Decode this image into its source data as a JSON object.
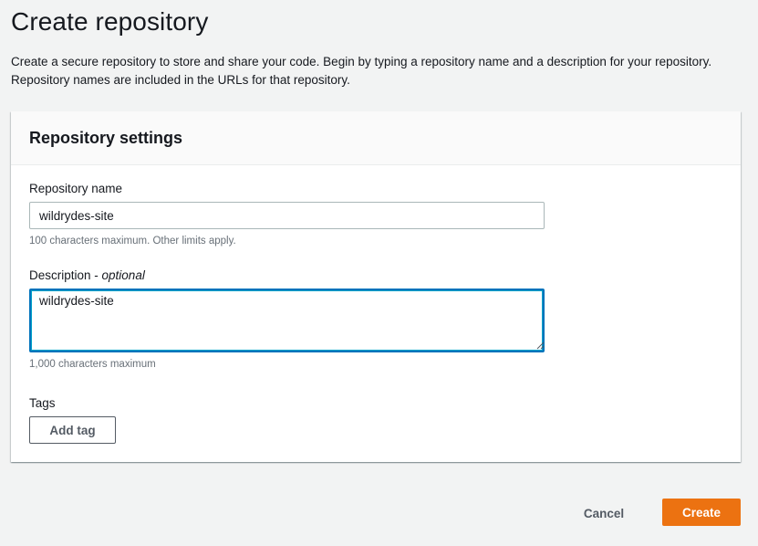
{
  "page": {
    "title": "Create repository",
    "description": "Create a secure repository to store and share your code. Begin by typing a repository name and a description for your repository. Repository names are included in the URLs for that repository."
  },
  "panel": {
    "title": "Repository settings",
    "repo_name": {
      "label": "Repository name",
      "value": "wildrydes-site",
      "hint": "100 characters maximum. Other limits apply."
    },
    "description": {
      "label": "Description",
      "label_suffix": "optional",
      "value": "wildrydes-site",
      "hint": "1,000 characters maximum"
    },
    "tags": {
      "label": "Tags",
      "add_button": "Add tag"
    }
  },
  "actions": {
    "cancel": "Cancel",
    "create": "Create"
  },
  "colors": {
    "primary": "#ec7211",
    "focus": "#0073bb",
    "text": "#16191f",
    "hint": "#687078"
  }
}
